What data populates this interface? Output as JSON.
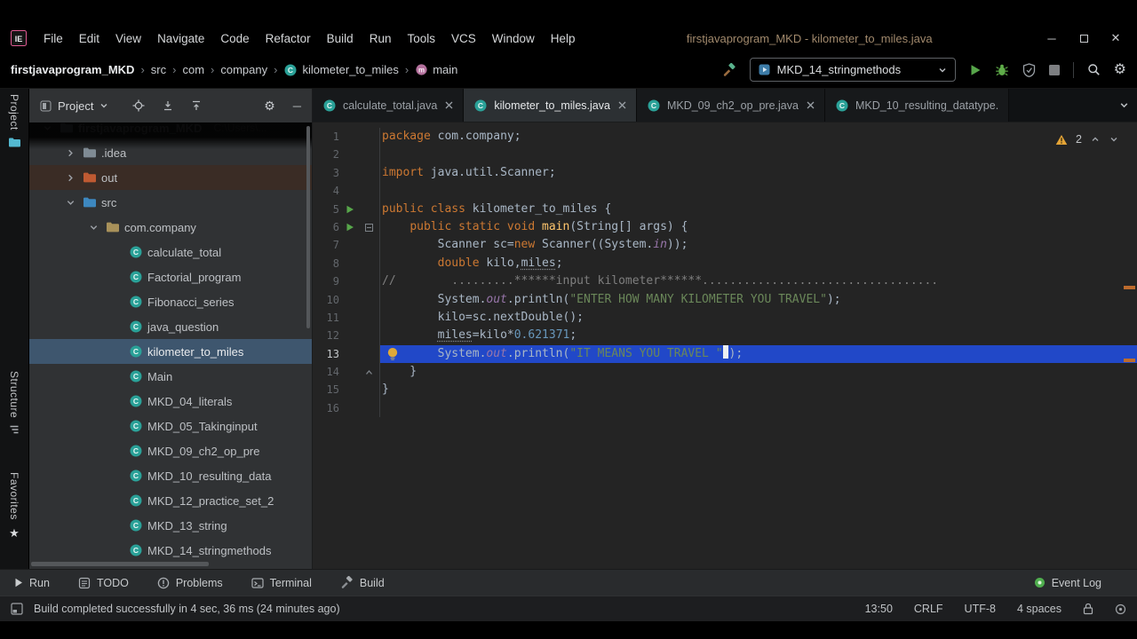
{
  "window": {
    "title": "firstjavaprogram_MKD - kilometer_to_miles.java",
    "menus": [
      "File",
      "Edit",
      "View",
      "Navigate",
      "Code",
      "Refactor",
      "Build",
      "Run",
      "Tools",
      "VCS",
      "Window",
      "Help"
    ]
  },
  "navbar": {
    "breadcrumbs": [
      {
        "label": "firstjavaprogram_MKD",
        "bold": true
      },
      {
        "label": "src"
      },
      {
        "label": "com"
      },
      {
        "label": "company"
      },
      {
        "label": "kilometer_to_miles",
        "icon": "class"
      },
      {
        "label": "main",
        "icon": "method"
      }
    ],
    "run_config": "MKD_14_stringmethods"
  },
  "tool_windows": {
    "project": "Project",
    "structure": "Structure",
    "favorites": "Favorites"
  },
  "project_panel": {
    "title": "Project",
    "tree": [
      {
        "label": "firstjavaprogram_MKD",
        "sub": "C:\\Users\\...",
        "depth": 0,
        "icon": "project",
        "chevron": "open",
        "variant": "root"
      },
      {
        "label": ".idea",
        "depth": 1,
        "icon": "folder",
        "chevron": "closed"
      },
      {
        "label": "out",
        "depth": 1,
        "icon": "folder-excluded",
        "chevron": "closed",
        "variant": "tint"
      },
      {
        "label": "src",
        "depth": 1,
        "icon": "folder-src",
        "chevron": "open"
      },
      {
        "label": "com.company",
        "depth": 2,
        "icon": "package",
        "chevron": "open"
      },
      {
        "label": "calculate_total",
        "depth": 3,
        "icon": "class"
      },
      {
        "label": "Factorial_program",
        "depth": 3,
        "icon": "class"
      },
      {
        "label": "Fibonacci_series",
        "depth": 3,
        "icon": "class"
      },
      {
        "label": "java_question",
        "depth": 3,
        "icon": "class"
      },
      {
        "label": "kilometer_to_miles",
        "depth": 3,
        "icon": "class",
        "selected": true
      },
      {
        "label": "Main",
        "depth": 3,
        "icon": "class"
      },
      {
        "label": "MKD_04_literals",
        "depth": 3,
        "icon": "class"
      },
      {
        "label": "MKD_05_Takinginput",
        "depth": 3,
        "icon": "class"
      },
      {
        "label": "MKD_09_ch2_op_pre",
        "depth": 3,
        "icon": "class"
      },
      {
        "label": "MKD_10_resulting_data",
        "depth": 3,
        "icon": "class"
      },
      {
        "label": "MKD_12_practice_set_2",
        "depth": 3,
        "icon": "class"
      },
      {
        "label": "MKD_13_string",
        "depth": 3,
        "icon": "class"
      },
      {
        "label": "MKD_14_stringmethods",
        "depth": 3,
        "icon": "class"
      }
    ]
  },
  "editor": {
    "tabs": [
      {
        "label": "calculate_total.java",
        "close": true
      },
      {
        "label": "kilometer_to_miles.java",
        "close": true,
        "active": true
      },
      {
        "label": "MKD_09_ch2_op_pre.java",
        "close": true
      },
      {
        "label": "MKD_10_resulting_datatype.",
        "close": false
      }
    ],
    "inspection_warnings": "2",
    "lines": [
      {
        "n": 1,
        "tokens": [
          {
            "t": "package ",
            "c": "kw"
          },
          {
            "t": "com.company;",
            "c": "pl"
          }
        ]
      },
      {
        "n": 2,
        "tokens": []
      },
      {
        "n": 3,
        "tokens": [
          {
            "t": "import ",
            "c": "kw"
          },
          {
            "t": "java.util.Scanner;",
            "c": "pl"
          }
        ]
      },
      {
        "n": 4,
        "tokens": []
      },
      {
        "n": 5,
        "run": true,
        "tokens": [
          {
            "t": "public class ",
            "c": "kw"
          },
          {
            "t": "kilometer_to_miles {",
            "c": "pl"
          }
        ]
      },
      {
        "n": 6,
        "run": true,
        "fold": "minus",
        "tokens": [
          {
            "t": "    ",
            "c": "pl"
          },
          {
            "t": "public static void ",
            "c": "kw"
          },
          {
            "t": "main",
            "c": "me"
          },
          {
            "t": "(String[] args) {",
            "c": "pl"
          }
        ]
      },
      {
        "n": 7,
        "tokens": [
          {
            "t": "        Scanner sc=",
            "c": "pl"
          },
          {
            "t": "new ",
            "c": "kw"
          },
          {
            "t": "Scanner((System.",
            "c": "pl"
          },
          {
            "t": "in",
            "c": "fi"
          },
          {
            "t": "));",
            "c": "pl"
          }
        ]
      },
      {
        "n": 8,
        "tokens": [
          {
            "t": "        ",
            "c": "pl"
          },
          {
            "t": "double ",
            "c": "kw"
          },
          {
            "t": "kilo,",
            "c": "pl"
          },
          {
            "t": "miles",
            "c": "uw"
          },
          {
            "t": ";",
            "c": "pl"
          }
        ]
      },
      {
        "n": 9,
        "tokens": [
          {
            "t": "//        .........******input kilometer******..................................",
            "c": "cm"
          }
        ]
      },
      {
        "n": 10,
        "tokens": [
          {
            "t": "        System.",
            "c": "pl"
          },
          {
            "t": "out",
            "c": "fi"
          },
          {
            "t": ".println(",
            "c": "pl"
          },
          {
            "t": "\"ENTER HOW MANY KILOMETER YOU TRAVEL\"",
            "c": "st"
          },
          {
            "t": ");",
            "c": "pl"
          }
        ]
      },
      {
        "n": 11,
        "tokens": [
          {
            "t": "        kilo=sc.nextDouble();",
            "c": "pl"
          }
        ]
      },
      {
        "n": 12,
        "tokens": [
          {
            "t": "        ",
            "c": "pl"
          },
          {
            "t": "miles",
            "c": "uw"
          },
          {
            "t": "=kilo*",
            "c": "pl"
          },
          {
            "t": "0.621371",
            "c": "nu"
          },
          {
            "t": ";",
            "c": "pl"
          }
        ]
      },
      {
        "n": 13,
        "highlight": true,
        "bulb": true,
        "tokens": [
          {
            "t": "        System.",
            "c": "pl"
          },
          {
            "t": "out",
            "c": "fi"
          },
          {
            "t": ".println(",
            "c": "pl"
          },
          {
            "t": "\"IT MEANS YOU TRAVEL \"",
            "c": "st"
          },
          {
            "t": "",
            "c": "caret"
          },
          {
            "t": ");",
            "c": "pl"
          }
        ]
      },
      {
        "n": 14,
        "fold": "end",
        "tokens": [
          {
            "t": "    }",
            "c": "pl"
          }
        ]
      },
      {
        "n": 15,
        "tokens": [
          {
            "t": "}",
            "c": "pl"
          }
        ]
      },
      {
        "n": 16,
        "tokens": []
      }
    ]
  },
  "bottom_bar": {
    "run": "Run",
    "todo": "TODO",
    "problems": "Problems",
    "terminal": "Terminal",
    "build": "Build",
    "event_log": "Event Log"
  },
  "status_bar": {
    "message": "Build completed successfully in 4 sec, 36 ms (24 minutes ago)",
    "caret": "13:50",
    "line_sep": "CRLF",
    "encoding": "UTF-8",
    "indent": "4 spaces"
  },
  "colors": {
    "keyword": "#cc7832",
    "string": "#6a8759",
    "number": "#6897bb",
    "comment": "#7f7f7f",
    "caret_line": "#2148c8",
    "run_green": "#57a64a",
    "warning": "#e3a336",
    "tree_selection": "#3e566e"
  }
}
